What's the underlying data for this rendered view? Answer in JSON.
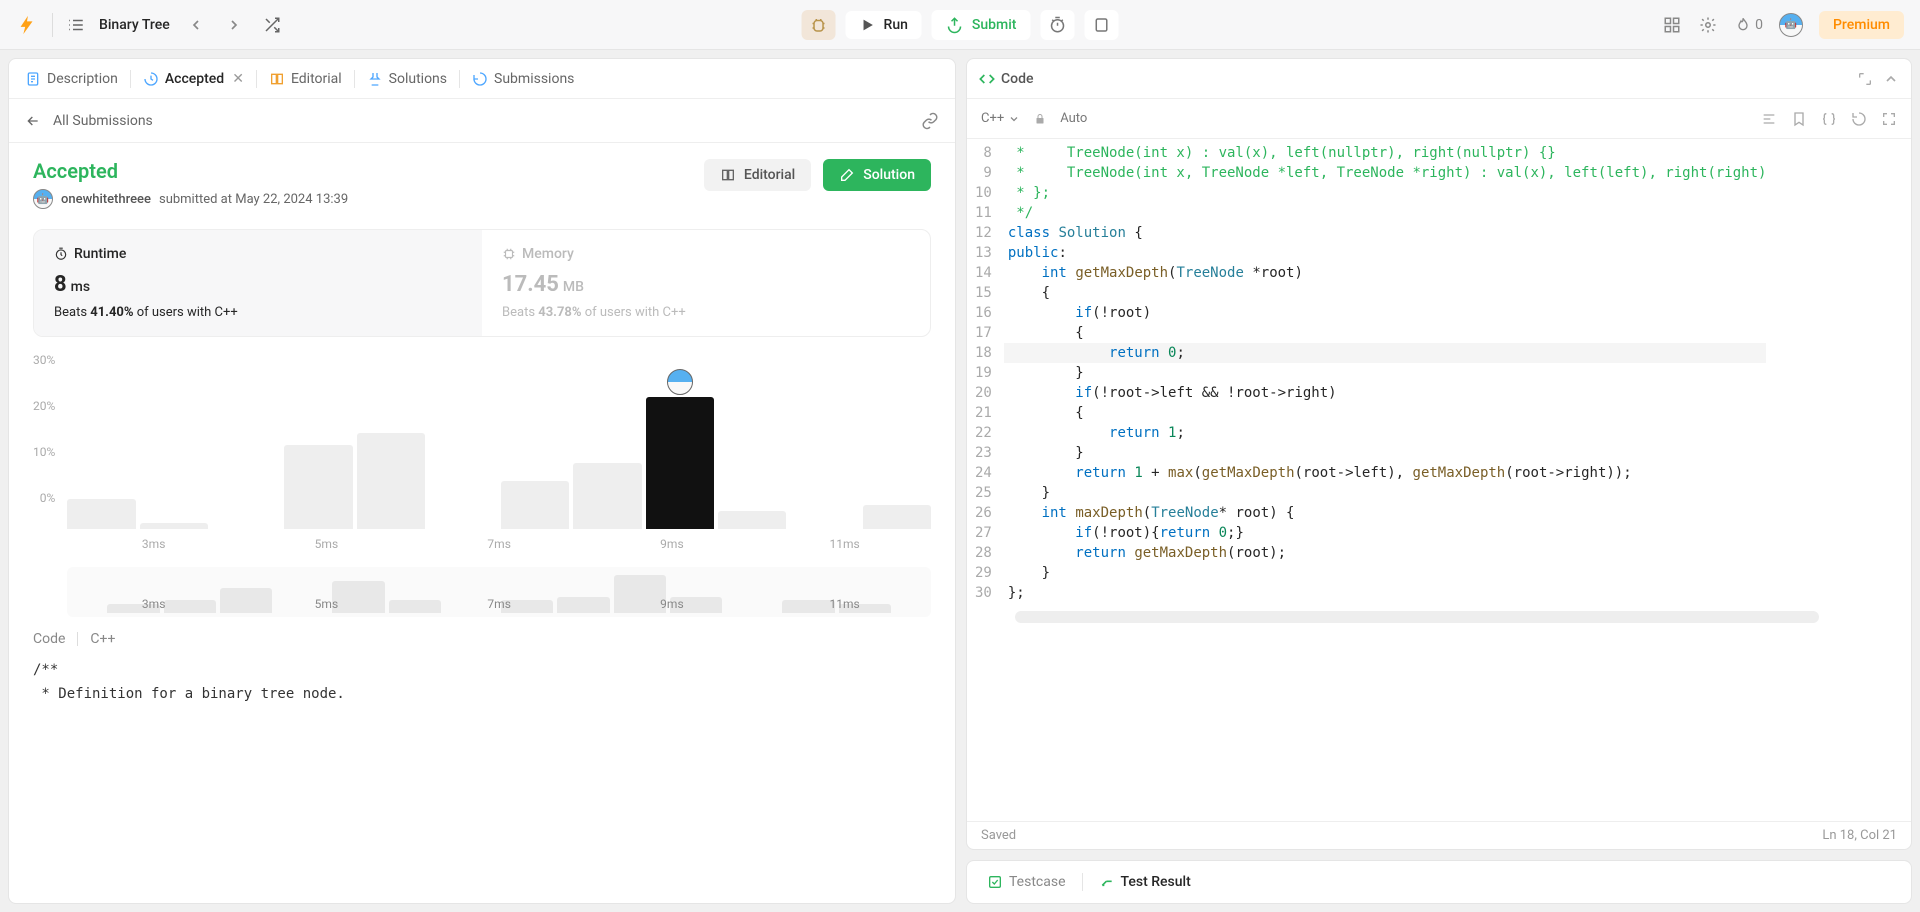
{
  "appbar": {
    "problem_title": "Binary Tree",
    "run_label": "Run",
    "submit_label": "Submit",
    "streak_count": "0",
    "premium_label": "Premium"
  },
  "left": {
    "tabs": {
      "description": "Description",
      "accepted": "Accepted",
      "editorial": "Editorial",
      "solutions": "Solutions",
      "submissions": "Submissions"
    },
    "subheader": {
      "back": "All Submissions"
    },
    "result": {
      "status": "Accepted",
      "user": "onewhitethreee",
      "submitted_at": "submitted at May 22, 2024 13:39",
      "editorial_btn": "Editorial",
      "solution_btn": "Solution"
    },
    "metrics": {
      "runtime_label": "Runtime",
      "runtime_value": "8",
      "runtime_unit": "ms",
      "runtime_beats_prefix": "Beats ",
      "runtime_beats_pct": "41.40%",
      "runtime_beats_suffix": " of users with C++",
      "memory_label": "Memory",
      "memory_value": "17.45",
      "memory_unit": "MB",
      "memory_beats_prefix": "Beats ",
      "memory_beats_pct": "43.78%",
      "memory_beats_suffix": " of users with C++"
    },
    "code_label": "Code",
    "code_lang": "C++",
    "code_snippet_l1": "/**",
    "code_snippet_l2": " * Definition for a binary tree node."
  },
  "chart_data": {
    "type": "bar",
    "ylabel": "",
    "ylim": [
      0,
      30
    ],
    "yticks": [
      "0%",
      "10%",
      "20%",
      "30%"
    ],
    "xticks": [
      "3ms",
      "5ms",
      "7ms",
      "9ms",
      "11ms"
    ],
    "values": [
      5,
      1,
      0,
      14,
      16,
      0,
      8,
      11,
      22,
      3,
      0,
      4
    ],
    "highlight_index": 8,
    "mini_values": [
      3,
      4,
      8,
      0,
      10,
      4,
      0,
      4,
      5,
      12,
      5,
      0,
      4,
      3
    ]
  },
  "right": {
    "code_tab": "Code",
    "lang": "C++",
    "auto": "Auto",
    "status_saved": "Saved",
    "cursor": "Ln 18, Col 21",
    "lines": [
      {
        "n": 8,
        "html": "<span class='tok-com'> *     TreeNode(int x) : val(x), left(nullptr), right(nullptr) {}</span>"
      },
      {
        "n": 9,
        "html": "<span class='tok-com'> *     TreeNode(int x, TreeNode *left, TreeNode *right) : val(x), left(left), right(right)</span>"
      },
      {
        "n": 10,
        "html": "<span class='tok-com'> * };</span>"
      },
      {
        "n": 11,
        "html": "<span class='tok-com'> */</span>"
      },
      {
        "n": 12,
        "html": "<span class='tok-kw'>class</span> <span class='tok-type'>Solution</span> {"
      },
      {
        "n": 13,
        "html": "<span class='tok-kw'>public</span>:"
      },
      {
        "n": 14,
        "html": "    <span class='tok-kw'>int</span> <span class='tok-fn'>getMaxDepth</span>(<span class='tok-type'>TreeNode</span> *root)"
      },
      {
        "n": 15,
        "html": "    {"
      },
      {
        "n": 16,
        "html": "        <span class='tok-kw'>if</span>(!root)"
      },
      {
        "n": 17,
        "html": "        {"
      },
      {
        "n": 18,
        "html": "            <span class='tok-kw'>return</span> <span class='tok-num'>0</span>;",
        "cur": true
      },
      {
        "n": 19,
        "html": "        }"
      },
      {
        "n": 20,
        "html": "        <span class='tok-kw'>if</span>(!root-&gt;left &amp;&amp; !root-&gt;right)"
      },
      {
        "n": 21,
        "html": "        {"
      },
      {
        "n": 22,
        "html": "            <span class='tok-kw'>return</span> <span class='tok-num'>1</span>;"
      },
      {
        "n": 23,
        "html": "        }"
      },
      {
        "n": 24,
        "html": "        <span class='tok-kw'>return</span> <span class='tok-num'>1</span> + <span class='tok-fn'>max</span>(<span class='tok-fn'>getMaxDepth</span>(root-&gt;left), <span class='tok-fn'>getMaxDepth</span>(root-&gt;right));"
      },
      {
        "n": 25,
        "html": "    }"
      },
      {
        "n": 26,
        "html": "    <span class='tok-kw'>int</span> <span class='tok-fn'>maxDepth</span>(<span class='tok-type'>TreeNode</span>* root) {"
      },
      {
        "n": 27,
        "html": "        <span class='tok-kw'>if</span>(!root){<span class='tok-kw'>return</span> <span class='tok-num'>0</span>;}"
      },
      {
        "n": 28,
        "html": "        <span class='tok-kw'>return</span> <span class='tok-fn'>getMaxDepth</span>(root);"
      },
      {
        "n": 29,
        "html": "    }"
      },
      {
        "n": 30,
        "html": "};"
      }
    ],
    "test_tabs": {
      "testcase": "Testcase",
      "test_result": "Test Result"
    }
  }
}
